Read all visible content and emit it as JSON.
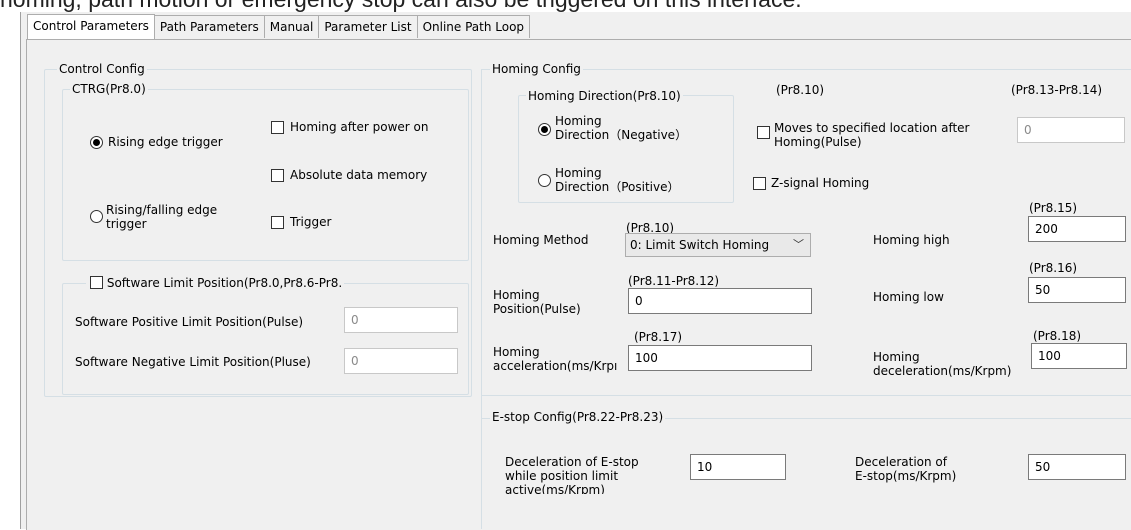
{
  "header_text": "homing, path motion or emergency stop can also be triggered on this interface.",
  "tabs": [
    "Control Parameters",
    "Path Parameters",
    "Manual",
    "Parameter List",
    "Online Path Loop"
  ],
  "control_config": {
    "title": "Control Config",
    "ctrg_title": "CTRG(Pr8.0)",
    "rising_edge": "Rising edge trigger",
    "rising_falling_1": "Rising/falling edge",
    "rising_falling_2": "trigger",
    "homing_after_power": "Homing after power on",
    "absolute_memory": "Absolute data memory",
    "trigger": "Trigger",
    "software_limit": "Software Limit Position(Pr8.0,Pr8.6-Pr8.",
    "pos_limit_label": "Software Positive Limit Position(Pulse)",
    "pos_limit_value": "0",
    "neg_limit_label": "Software Negative Limit Position(Pluse)",
    "neg_limit_value": "0"
  },
  "homing_config": {
    "title": "Homing Config",
    "direction_title": "Homing Direction(Pr8.10)",
    "neg_1": "Homing",
    "neg_2": "Direction（Negative）",
    "pos_1": "Homing",
    "pos_2": "Direction（Positive）",
    "pr810_label": "(Pr8.10)",
    "pr813_label": "(Pr8.13-Pr8.14)",
    "moves_1": "Moves to specified location after",
    "moves_2": "Homing(Pulse)",
    "moves_value": "0",
    "zsignal": "Z-signal Homing",
    "method_label": "Homing Method",
    "method_pr": "(Pr8.10)",
    "method_value": "0: Limit Switch Homing",
    "high_label": "Homing high",
    "high_pr": "(Pr8.15)",
    "high_value": "200",
    "position_label_1": "Homing",
    "position_label_2": "Position(Pulse)",
    "position_pr": "(Pr8.11-Pr8.12)",
    "position_value": "0",
    "low_label": "Homing low",
    "low_pr": "(Pr8.16)",
    "low_value": "50",
    "accel_label_1": "Homing",
    "accel_label_2": "acceleration(ms/Krpı",
    "accel_pr": "(Pr8.17)",
    "accel_value": "100",
    "decel_label_1": "Homing",
    "decel_label_2": "deceleration(ms/Krpm)",
    "decel_pr": "(Pr8.18)",
    "decel_value": "100"
  },
  "estop_config": {
    "title": "E-stop Config(Pr8.22-Pr8.23)",
    "decel_limit_1": "Deceleration of E-stop",
    "decel_limit_2": "while position limit",
    "decel_limit_3": "active(ms/Krpm)",
    "decel_limit_value": "10",
    "decel_estop_1": "Deceleration of",
    "decel_estop_2": "E-stop(ms/Krpm)",
    "decel_estop_value": "50"
  }
}
